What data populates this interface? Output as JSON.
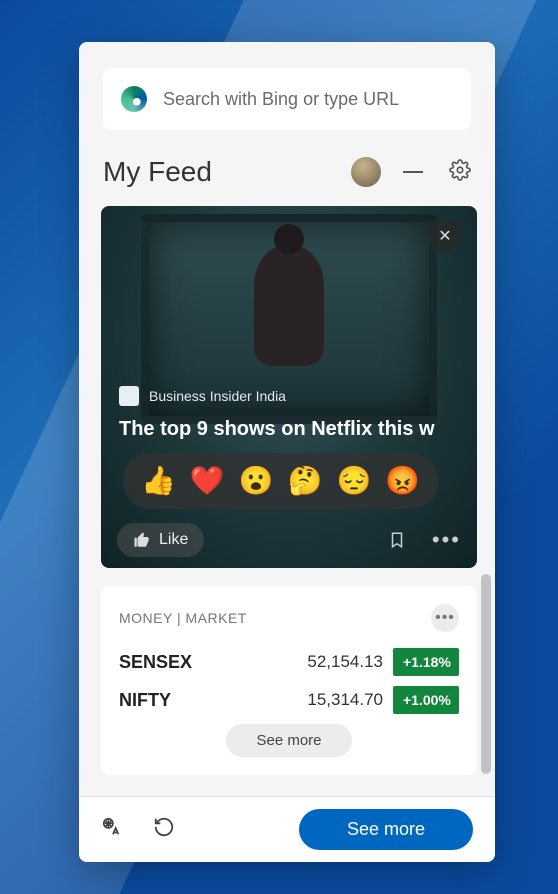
{
  "search": {
    "placeholder": "Search with Bing or type URL"
  },
  "header": {
    "title": "My Feed"
  },
  "news": {
    "source": "Business Insider India",
    "headline": "The top 9 shows on Netflix this w",
    "like_label": "Like",
    "reactions": [
      "👍",
      "❤️",
      "😮",
      "🤔",
      "😔",
      "😡"
    ]
  },
  "money": {
    "label": "MONEY | MARKET",
    "rows": [
      {
        "name": "SENSEX",
        "value": "52,154.13",
        "change": "+1.18%"
      },
      {
        "name": "NIFTY",
        "value": "15,314.70",
        "change": "+1.00%"
      }
    ],
    "see_more": "See more"
  },
  "footer": {
    "see_more": "See more"
  }
}
